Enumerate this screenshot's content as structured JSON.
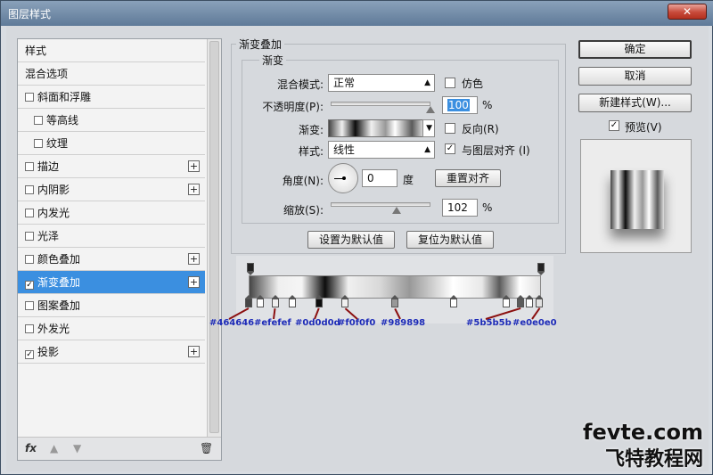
{
  "window": {
    "title": "图层样式",
    "close_label": "✕"
  },
  "sidebar": {
    "items": [
      {
        "label": "样式",
        "check": false,
        "has_checkbox": false,
        "plus": false,
        "indent": false
      },
      {
        "label": "混合选项",
        "check": false,
        "has_checkbox": false,
        "plus": false,
        "indent": false
      },
      {
        "label": "斜面和浮雕",
        "check": false,
        "has_checkbox": true,
        "plus": false,
        "indent": false
      },
      {
        "label": "等高线",
        "check": false,
        "has_checkbox": true,
        "plus": false,
        "indent": true
      },
      {
        "label": "纹理",
        "check": false,
        "has_checkbox": true,
        "plus": false,
        "indent": true
      },
      {
        "label": "描边",
        "check": false,
        "has_checkbox": true,
        "plus": true,
        "indent": false
      },
      {
        "label": "内阴影",
        "check": false,
        "has_checkbox": true,
        "plus": true,
        "indent": false
      },
      {
        "label": "内发光",
        "check": false,
        "has_checkbox": true,
        "plus": false,
        "indent": false
      },
      {
        "label": "光泽",
        "check": false,
        "has_checkbox": true,
        "plus": false,
        "indent": false
      },
      {
        "label": "颜色叠加",
        "check": false,
        "has_checkbox": true,
        "plus": true,
        "indent": false
      },
      {
        "label": "渐变叠加",
        "check": true,
        "has_checkbox": true,
        "plus": true,
        "indent": false,
        "selected": true
      },
      {
        "label": "图案叠加",
        "check": false,
        "has_checkbox": true,
        "plus": false,
        "indent": false
      },
      {
        "label": "外发光",
        "check": false,
        "has_checkbox": true,
        "plus": false,
        "indent": false
      },
      {
        "label": "投影",
        "check": true,
        "has_checkbox": true,
        "plus": true,
        "indent": false
      }
    ],
    "bottom": {
      "fx_label": "fx",
      "trash_icon": "trash-icon"
    }
  },
  "gradient_overlay": {
    "group_title": "渐变叠加",
    "sub_title": "渐变",
    "blend_mode_label": "混合模式:",
    "blend_mode_value": "正常",
    "dither_label": "仿色",
    "opacity_label": "不透明度(P):",
    "opacity_value": "100",
    "opacity_percent": 100,
    "percent": "%",
    "gradient_label": "渐变:",
    "reverse_label": "反向(R)",
    "style_label": "样式:",
    "style_value": "线性",
    "align_label": "与图层对齐 (I)",
    "angle_label": "角度(N):",
    "angle_value": "0",
    "degree": "度",
    "reset_align_label": "重置对齐",
    "scale_label": "缩放(S):",
    "scale_value": "102",
    "scale_percent": 102,
    "set_default_label": "设置为默认值",
    "reset_default_label": "复位为默认值"
  },
  "gradient_stops": [
    {
      "color": "#464646",
      "label": "#464646"
    },
    {
      "color": "#efefef",
      "label": "#efefef"
    },
    {
      "color": "#0d0d0d",
      "label": "#0d0d0d"
    },
    {
      "color": "#f0f0f0",
      "label": "#f0f0f0"
    },
    {
      "color": "#989898",
      "label": "#989898"
    },
    {
      "color": "#5b5b5b",
      "label": "#5b5b5b"
    },
    {
      "color": "#e0e0e0",
      "label": "#e0e0e0"
    }
  ],
  "right": {
    "ok_label": "确定",
    "cancel_label": "取消",
    "new_style_label": "新建样式(W)...",
    "preview_label": "预览(V)",
    "preview_checked": true
  },
  "watermark": {
    "line1": "fevte.com",
    "line2": "飞特教程网"
  }
}
